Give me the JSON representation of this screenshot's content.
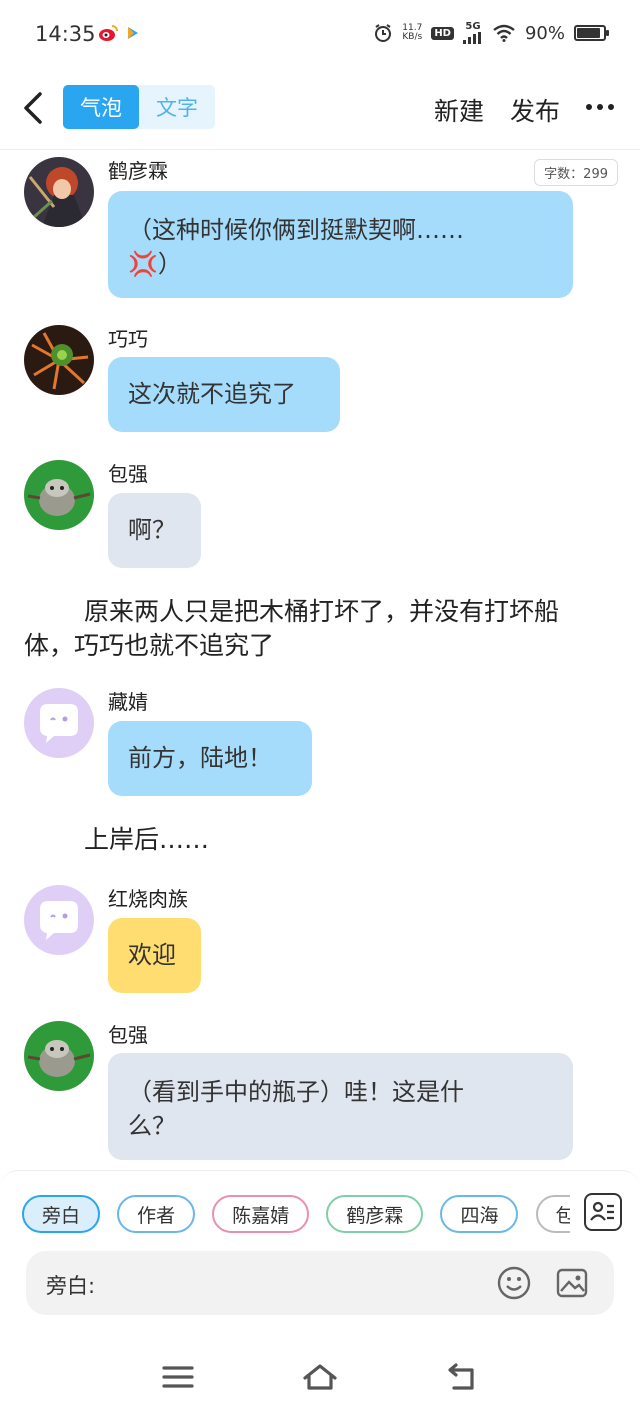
{
  "status": {
    "time": "14:35",
    "netspeed_top": "11.7",
    "netspeed_unit": "KB/s",
    "hd": "HD",
    "signal": "5G",
    "battery": "90%",
    "battery_level": 0.9
  },
  "topbar": {
    "mode_bubble": "气泡",
    "mode_text": "文字",
    "new_label": "新建",
    "publish_label": "发布"
  },
  "chat": {
    "word_count": "字数：299",
    "messages": [
      {
        "sender": "鹤彦霖",
        "text_line1": "（这种时候你俩到挺默契啊……",
        "text_line2_suffix": "）",
        "emoji": "💢"
      },
      {
        "sender": "巧巧",
        "text": "这次就不追究了"
      },
      {
        "sender": "包强",
        "text": "啊？"
      },
      {
        "narration": "原来两人只是把木桶打坏了，并没有打坏船体，巧巧也就不追究了"
      },
      {
        "sender": "藏婧",
        "text": "前方，陆地！"
      },
      {
        "narration": "上岸后……"
      },
      {
        "sender": "红烧肉族",
        "text": "欢迎"
      },
      {
        "sender": "包强",
        "text_line1": "（看到手中的瓶子）哇！这是什",
        "text_line2": "么？"
      }
    ]
  },
  "composer": {
    "roles": [
      "旁白",
      "作者",
      "陈嘉婧",
      "鹤彦霖",
      "四海",
      "包强"
    ],
    "input_label": "旁白:"
  },
  "colors": {
    "accent": "#2aa5f0",
    "bubble_blue": "#a6dcfb",
    "bubble_gray": "#e0e6ef",
    "bubble_yellow": "#ffdd71"
  }
}
